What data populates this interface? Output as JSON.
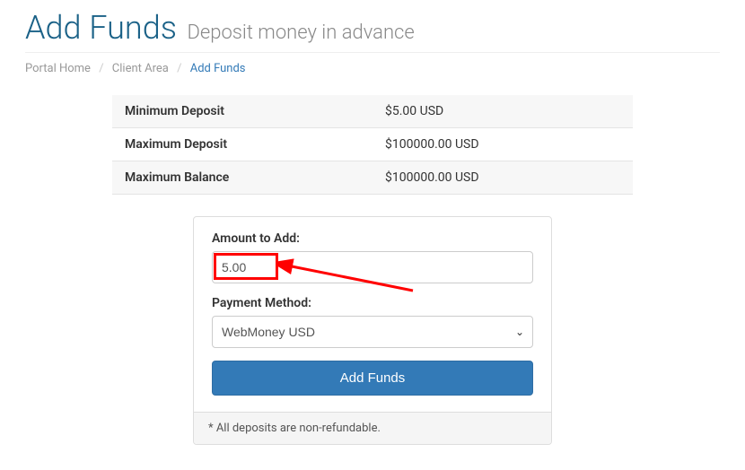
{
  "header": {
    "title": "Add Funds",
    "subtitle": "Deposit money in advance"
  },
  "breadcrumb": {
    "home": "Portal Home",
    "client": "Client Area",
    "current": "Add Funds"
  },
  "limits": {
    "min_label": "Minimum Deposit",
    "min_value": "$5.00 USD",
    "max_label": "Maximum Deposit",
    "max_value": "$100000.00 USD",
    "bal_label": "Maximum Balance",
    "bal_value": "$100000.00 USD"
  },
  "form": {
    "amount_label": "Amount to Add:",
    "amount_value": "5.00",
    "method_label": "Payment Method:",
    "method_selected": "WebMoney USD",
    "submit_label": "Add Funds"
  },
  "footer": {
    "note": "* All deposits are non-refundable."
  },
  "colors": {
    "primary": "#337ab7",
    "title": "#1a6187",
    "highlight": "#ff0000"
  }
}
